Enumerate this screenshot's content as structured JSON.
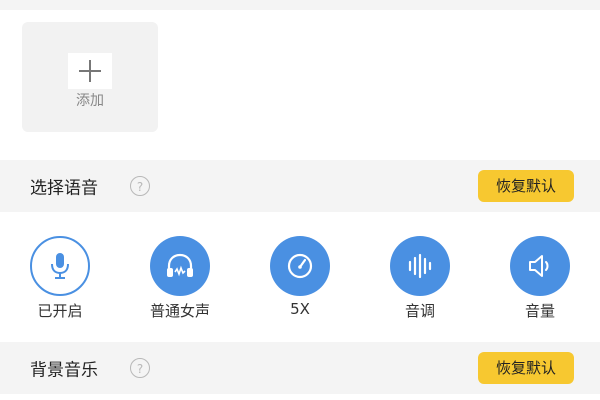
{
  "add_tile": {
    "label": "添加"
  },
  "sections": [
    {
      "title": "选择语音",
      "help_symbol": "?",
      "reset_label": "恢复默认"
    },
    {
      "title": "背景音乐",
      "help_symbol": "?",
      "reset_label": "恢复默认"
    }
  ],
  "voice_options": [
    {
      "label": "已开启",
      "icon": "microphone-icon",
      "state": "outlined"
    },
    {
      "label": "普通女声",
      "icon": "headphones-icon",
      "state": "filled"
    },
    {
      "label": "5X",
      "icon": "speedometer-icon",
      "state": "filled"
    },
    {
      "label": "音调",
      "icon": "soundwave-icon",
      "state": "filled"
    },
    {
      "label": "音量",
      "icon": "speaker-icon",
      "state": "filled"
    }
  ],
  "colors": {
    "accent_blue": "#4a90e2",
    "reset_yellow": "#f7c830",
    "section_bg": "#f4f4f4"
  }
}
